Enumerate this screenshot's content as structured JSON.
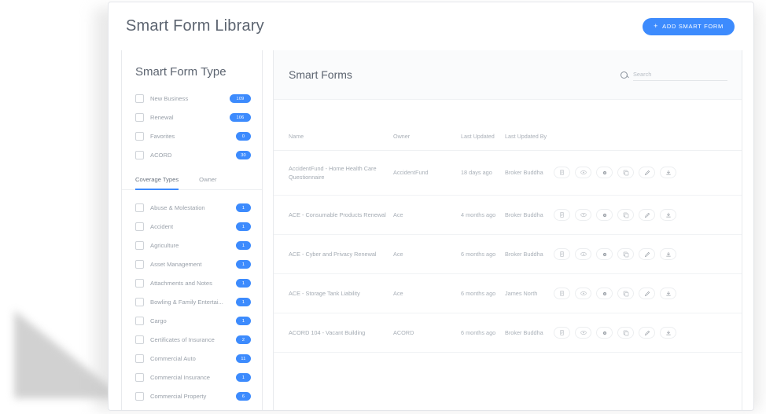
{
  "app": {
    "title": "Smart Form Library",
    "add_button": {
      "label": "ADD SMART FORM",
      "icon": "plus-icon",
      "color": "#3d8bfd"
    }
  },
  "sidebar": {
    "title": "Smart Form Type",
    "type_filters": [
      {
        "label": "New Business",
        "count": "109"
      },
      {
        "label": "Renewal",
        "count": "106"
      },
      {
        "label": "Favorites",
        "count": "0"
      },
      {
        "label": "ACORD",
        "count": "30"
      }
    ],
    "tabs": [
      {
        "label": "Coverage Types",
        "active": true
      },
      {
        "label": "Owner",
        "active": false
      }
    ],
    "coverage_filters": [
      {
        "label": "Abuse & Molestation",
        "count": "1"
      },
      {
        "label": "Accident",
        "count": "1"
      },
      {
        "label": "Agriculture",
        "count": "1"
      },
      {
        "label": "Asset Management",
        "count": "1"
      },
      {
        "label": "Attachments and Notes",
        "count": "1"
      },
      {
        "label": "Bowling & Family Entertai...",
        "count": "1"
      },
      {
        "label": "Cargo",
        "count": "1"
      },
      {
        "label": "Certificates of Insurance",
        "count": "2"
      },
      {
        "label": "Commercial Auto",
        "count": "11"
      },
      {
        "label": "Commercial Insurance",
        "count": "1"
      },
      {
        "label": "Commercial Property",
        "count": "6"
      }
    ]
  },
  "main": {
    "title": "Smart Forms",
    "search": {
      "placeholder": "Search",
      "value": "",
      "icon": "search-icon"
    },
    "columns": [
      "Name",
      "Owner",
      "Last Updated",
      "Last Updated By",
      ""
    ],
    "rows": [
      {
        "name": "AccidentFund - Home Health Care Questionnaire",
        "owner": "AccidentFund",
        "last_updated": "18 days ago",
        "last_updated_by": "Broker Buddha"
      },
      {
        "name": "ACE - Consumable Products Renewal",
        "owner": "Ace",
        "last_updated": "4 months ago",
        "last_updated_by": "Broker Buddha"
      },
      {
        "name": "ACE - Cyber and Privacy Renewal",
        "owner": "Ace",
        "last_updated": "6 months ago",
        "last_updated_by": "Broker Buddha"
      },
      {
        "name": "ACE - Storage Tank Liability",
        "owner": "Ace",
        "last_updated": "6 months ago",
        "last_updated_by": "James North"
      },
      {
        "name": "ACORD 104 - Vacant Building",
        "owner": "ACORD",
        "last_updated": "6 months ago",
        "last_updated_by": "Broker Buddha"
      }
    ],
    "row_actions": [
      "document-icon",
      "eye-icon",
      "link-icon",
      "copy-icon",
      "edit-icon",
      "download-icon"
    ]
  }
}
